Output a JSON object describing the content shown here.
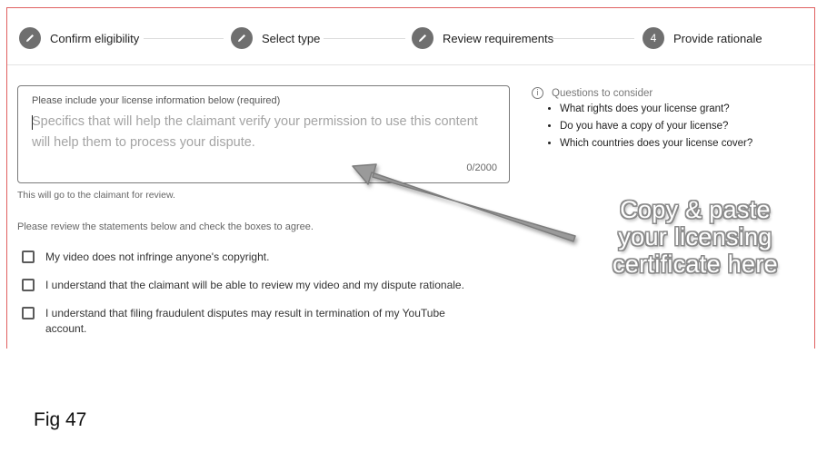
{
  "stepper": {
    "steps": [
      {
        "label": "Confirm eligibility",
        "icon": "pencil-icon"
      },
      {
        "label": "Select type",
        "icon": "pencil-icon"
      },
      {
        "label": "Review requirements",
        "icon": "pencil-icon"
      },
      {
        "label": "Provide rationale",
        "number": "4"
      }
    ]
  },
  "license_field": {
    "label": "Please include your license information below (required)",
    "placeholder": "Specifics that will help the claimant verify your permission to use this content will help them to process your dispute.",
    "counter": "0/2000",
    "helper_text": "This will go to the claimant for review."
  },
  "review_prompt": "Please review the statements below and check the boxes to agree.",
  "checkboxes": [
    {
      "label": "My video does not infringe anyone's copyright.",
      "checked": false
    },
    {
      "label": "I understand that the claimant will be able to review my video and my dispute rationale.",
      "checked": false
    },
    {
      "label": "I understand that filing fraudulent disputes may result in termination of my YouTube account.",
      "checked": false
    }
  ],
  "questions": {
    "heading": "Questions to consider",
    "items": [
      "What rights does your license grant?",
      "Do you have a copy of your license?",
      "Which countries does your license cover?"
    ]
  },
  "annotation": {
    "lines": [
      "Copy & paste",
      "your licensing",
      "certificate here"
    ]
  },
  "caption": "Fig 47",
  "colors": {
    "step_circle": "#6f6f6f",
    "frame_border": "#e06060",
    "annotation_stroke": "#8a8a8a"
  }
}
